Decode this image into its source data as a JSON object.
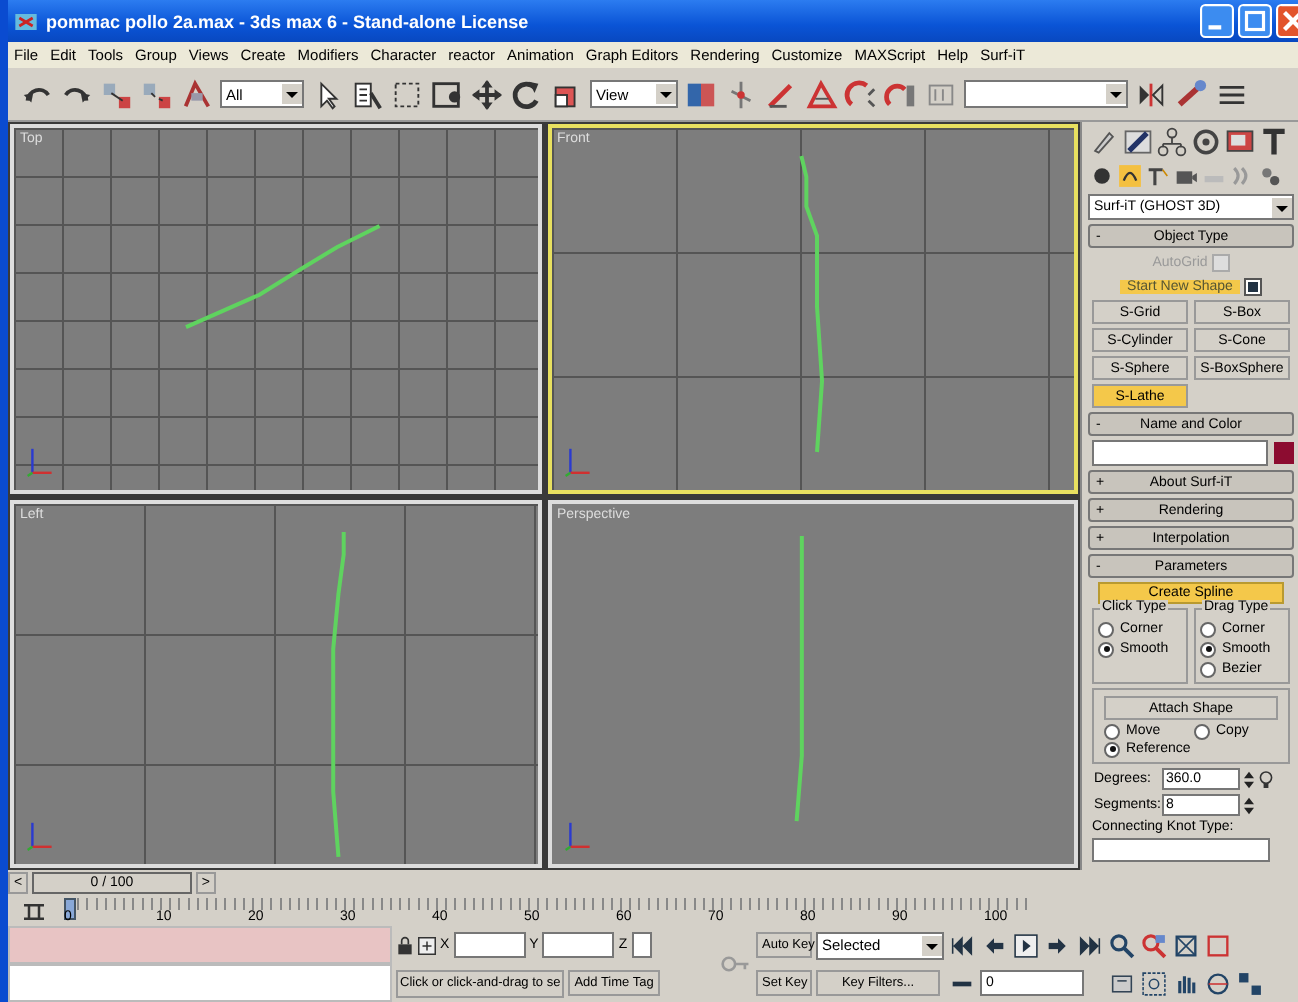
{
  "window": {
    "title": "pommac pollo 2a.max - 3ds max 6 - Stand-alone License"
  },
  "menu": [
    "File",
    "Edit",
    "Tools",
    "Group",
    "Views",
    "Create",
    "Modifiers",
    "Character",
    "reactor",
    "Animation",
    "Graph Editors",
    "Rendering",
    "Customize",
    "MAXScript",
    "Help",
    "Surf-iT"
  ],
  "toolbar": {
    "selection_filter": "All",
    "reference_coordinate": "View"
  },
  "viewports": [
    {
      "label": "Top",
      "active": false
    },
    {
      "label": "Front",
      "active": true
    },
    {
      "label": "Left",
      "active": false
    },
    {
      "label": "Perspective",
      "active": false
    }
  ],
  "command_panel": {
    "plugin_dropdown": "Surf-iT (GHOST 3D)",
    "object_type": {
      "sign": "-",
      "title": "Object Type",
      "autogrid": {
        "label": "AutoGrid",
        "checked": false,
        "disabled": true
      },
      "start_new_shape": {
        "label": "Start New Shape",
        "checked": true
      },
      "buttons": [
        {
          "label": "S-Grid",
          "selected": false
        },
        {
          "label": "S-Box",
          "selected": false
        },
        {
          "label": "S-Cylinder",
          "selected": false
        },
        {
          "label": "S-Cone",
          "selected": false
        },
        {
          "label": "S-Sphere",
          "selected": false
        },
        {
          "label": "S-BoxSphere",
          "selected": false
        },
        {
          "label": "S-Lathe",
          "selected": true
        }
      ]
    },
    "name_and_color": {
      "sign": "-",
      "title": "Name and Color",
      "color": "#8c0c30"
    },
    "rollouts": [
      {
        "sign": "+",
        "title": "About Surf-iT"
      },
      {
        "sign": "+",
        "title": "Rendering"
      },
      {
        "sign": "+",
        "title": "Interpolation"
      },
      {
        "sign": "-",
        "title": "Parameters"
      }
    ],
    "parameters": {
      "create_spline": "Create Spline",
      "click_type": {
        "title": "Click Type",
        "options": [
          {
            "label": "Corner",
            "selected": false
          },
          {
            "label": "Smooth",
            "selected": true
          }
        ]
      },
      "drag_type": {
        "title": "Drag Type",
        "options": [
          {
            "label": "Corner",
            "selected": false
          },
          {
            "label": "Smooth",
            "selected": true
          },
          {
            "label": "Bezier",
            "selected": false
          }
        ]
      },
      "attach_shape": {
        "button": "Attach Shape",
        "options": [
          {
            "label": "Move",
            "selected": false
          },
          {
            "label": "Copy",
            "selected": false
          },
          {
            "label": "Reference",
            "selected": true
          }
        ]
      },
      "degrees": {
        "label": "Degrees:",
        "value": "360.0"
      },
      "segments": {
        "label": "Segments:",
        "value": "8"
      },
      "knot_type_label": "Connecting Knot Type:"
    }
  },
  "timeline": {
    "position": "0 / 100",
    "prev": "<",
    "next": ">",
    "ticks": [
      "0",
      "10",
      "20",
      "30",
      "40",
      "50",
      "60",
      "70",
      "80",
      "90",
      "100"
    ]
  },
  "status": {
    "x_label": "X",
    "y_label": "Y",
    "z_label": "Z",
    "prompt": "Click or click-and-drag to se",
    "add_time_tag": "Add Time Tag",
    "auto_key": "Auto Key",
    "key_mode": "Selected",
    "set_key": "Set Key",
    "key_filters": "Key Filters...",
    "frame": "0"
  }
}
